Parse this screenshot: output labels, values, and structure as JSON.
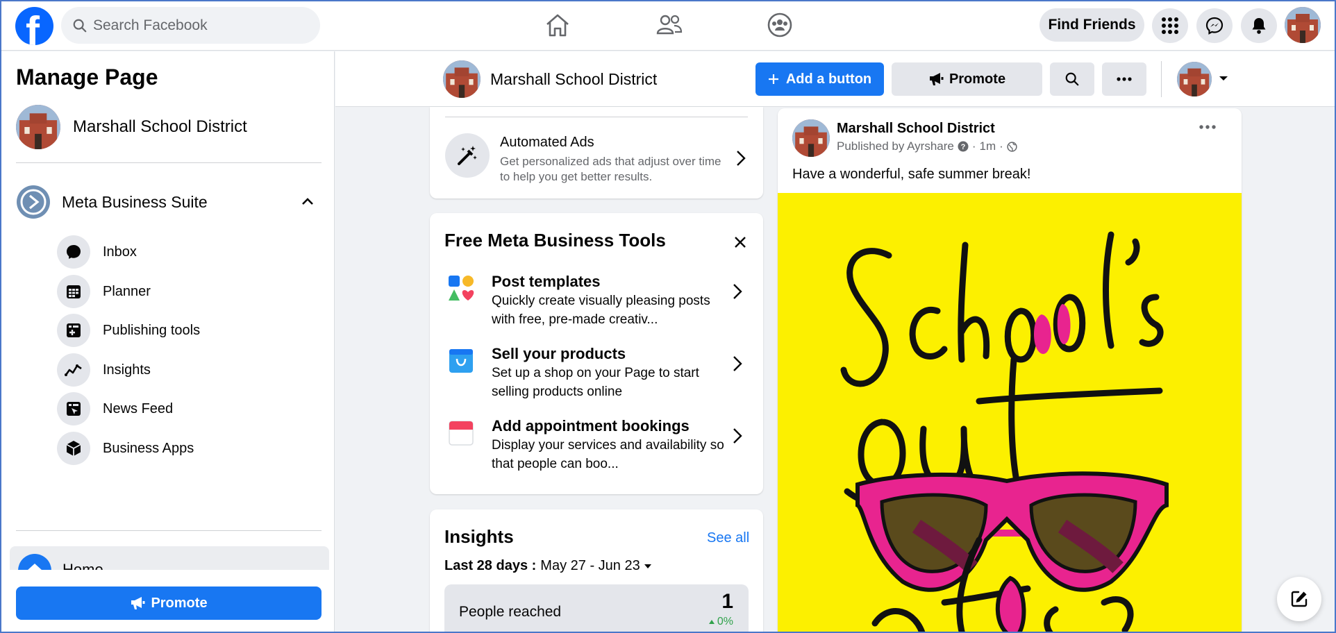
{
  "top_nav": {
    "search": {
      "placeholder": "Search Facebook"
    },
    "find_friends": "Find Friends",
    "icons": [
      "home-icon",
      "friends-icon",
      "groups-icon",
      "menu-grid-icon",
      "messenger-icon",
      "notifications-icon"
    ]
  },
  "sidebar": {
    "title": "Manage Page",
    "page_name": "Marshall School District",
    "suite": {
      "label": "Meta Business Suite",
      "expanded": true
    },
    "items": [
      {
        "label": "Inbox",
        "icon": "inbox-icon"
      },
      {
        "label": "Planner",
        "icon": "planner-icon"
      },
      {
        "label": "Publishing tools",
        "icon": "publishing-tools-icon"
      },
      {
        "label": "Insights",
        "icon": "insights-icon"
      },
      {
        "label": "News Feed",
        "icon": "news-feed-icon"
      },
      {
        "label": "Business Apps",
        "icon": "business-apps-icon"
      }
    ],
    "home": "Home",
    "promote": "Promote"
  },
  "page_header": {
    "page_name": "Marshall School District",
    "add_button": "Add a button",
    "promote": "Promote"
  },
  "automated_ads": {
    "title": "Automated Ads",
    "description": "Get personalized ads that adjust over time to help you get better results."
  },
  "tools": {
    "title": "Free Meta Business Tools",
    "items": [
      {
        "title": "Post templates",
        "desc": "Quickly create visually pleasing posts with free, pre-made creativ..."
      },
      {
        "title": "Sell your products",
        "desc": "Set up a shop on your Page to start selling products online"
      },
      {
        "title": "Add appointment bookings",
        "desc": "Display your services and availability so that people can boo..."
      }
    ]
  },
  "insights": {
    "title": "Insights",
    "see_all": "See all",
    "range_label": "Last 28 days :",
    "range_value": "May 27 - Jun 23",
    "metric_label": "People reached",
    "metric_value": "1",
    "metric_change": "0%"
  },
  "post": {
    "author": "Marshall School District",
    "published_by": "Published by Ayrshare",
    "time": "1m",
    "text": "Have a wonderful, safe summer break!",
    "image_bg": "#fcf000",
    "image_accent": "#e8248f"
  },
  "colors": {
    "brand_blue": "#1877f2",
    "fb_logo": "#0866ff",
    "positive_green": "#31a24c"
  }
}
